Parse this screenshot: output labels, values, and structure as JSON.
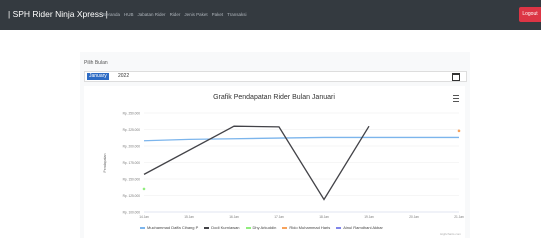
{
  "navbar": {
    "brand": "| SPH Rider Ninja Xpress |",
    "links": [
      "Beranda",
      "HUB",
      "Jabatan Rider",
      "Rider",
      "Jenis Paket",
      "Paket",
      "Transaksi"
    ],
    "logout": "Logout"
  },
  "form": {
    "pick_label": "Pilih Bulan",
    "month": "January",
    "year": "2022"
  },
  "chart_data": {
    "type": "line",
    "title": "Grafik Pendapatan Rider Bulan Januari",
    "ylabel": "Pendapatan",
    "xlabel": "",
    "x": [
      "14 Jan",
      "15 Jan",
      "16 Jan",
      "17 Jan",
      "18 Jan",
      "19 Jan",
      "20 Jan",
      "21 Jan"
    ],
    "y_ticks": [
      "Rp. 100.000",
      "Rp. 125.000",
      "Rp. 150.000",
      "Rp. 175.000",
      "Rp. 200.000",
      "Rp. 225.000",
      "Rp. 250.000"
    ],
    "ylim": [
      100000,
      250000
    ],
    "series": [
      {
        "name": "Muchammad Daffa Cihang P",
        "color": "#7cb5ec",
        "values": [
          208000,
          210000,
          211000,
          212000,
          213000,
          213000,
          213000,
          213000
        ]
      },
      {
        "name": "Dodi Kurniawan",
        "color": "#434348",
        "values": [
          157000,
          null,
          230000,
          229000,
          119000,
          230000,
          null,
          null
        ]
      },
      {
        "name": "Dhy Arkuddin",
        "color": "#90ed7d",
        "values": [
          135000,
          null,
          null,
          null,
          null,
          null,
          null,
          null
        ]
      },
      {
        "name": "Rido Muhammad Haris",
        "color": "#f7a35c",
        "values": [
          null,
          null,
          null,
          null,
          null,
          null,
          null,
          223000
        ]
      },
      {
        "name": "Ainul Ramdhani Akbar",
        "color": "#8085e9",
        "values": [
          null,
          null,
          null,
          null,
          null,
          null,
          null,
          null
        ]
      }
    ],
    "legend_position": "bottom",
    "grid": true,
    "credit": "Highcharts.com"
  }
}
